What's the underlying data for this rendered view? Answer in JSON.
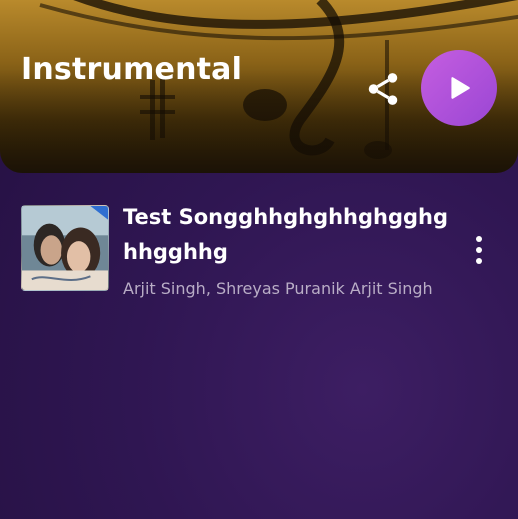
{
  "playlist": {
    "title": "Instrumental"
  },
  "header_actions": {
    "share_icon": "share-icon",
    "play_icon": "play-icon",
    "play_color": "#a64fd8"
  },
  "songs": [
    {
      "title": "Test Songghhghghhghgghghhgghhg",
      "artists": "Arjit Singh, Shreyas Puranik Arjit Singh",
      "menu_icon": "more-vertical-icon"
    }
  ]
}
